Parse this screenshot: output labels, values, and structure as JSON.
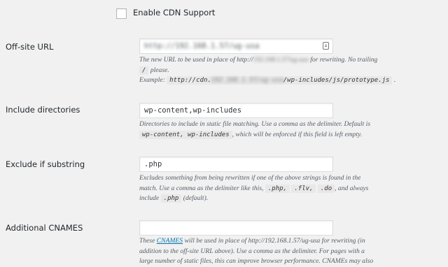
{
  "cdn": {
    "label": "Enable CDN Support"
  },
  "offsite": {
    "label": "Off-site URL",
    "value": "http://192.168.1.57/ug-usa",
    "desc_pre": "The new URL to be used in place of http://",
    "desc_blur": "192.168.1.57/ug-usa",
    "desc_post": " for rewriting. No trailing",
    "slash": "/",
    "please": " please.",
    "example_label": "Example: ",
    "example_code_pre": "http://cdn.",
    "example_code_blur": "192.168.1.57/ug-usa",
    "example_code_post": "/wp-includes/js/prototype.js",
    "example_end": " ."
  },
  "include": {
    "label": "Include directories",
    "value": "wp-content,wp-includes",
    "desc_line1": "Directories to include in static file matching. Use a comma as the delimiter. Default is",
    "desc_code": "wp-content, wp-includes",
    "desc_line2": ", which will be enforced if this field is left empty."
  },
  "exclude": {
    "label": "Exclude if substring",
    "value": ".php",
    "desc_line1": "Excludes something from being rewritten if one of the above strings is found in the",
    "desc_line2a": "match. Use a comma as the delimiter like this,",
    "code1": ".php,",
    "code2": ".flv,",
    "code3": ".do",
    "desc_line2b": ", and always",
    "desc_line3a": "include",
    "code4": ".php",
    "desc_line3b": "(default)."
  },
  "cnames": {
    "label": "Additional CNAMES",
    "value": "",
    "desc_pre": "These ",
    "link": "CNAMES",
    "desc_line1": " will be used in place of http://192.168.1.57/ug-usa for rewriting (in",
    "desc_line2": "addition to the off-site URL above). Use a comma as the delimiter. For pages with a",
    "desc_line3": "large number of static files, this can improve browser performance. CNAMEs may also"
  }
}
